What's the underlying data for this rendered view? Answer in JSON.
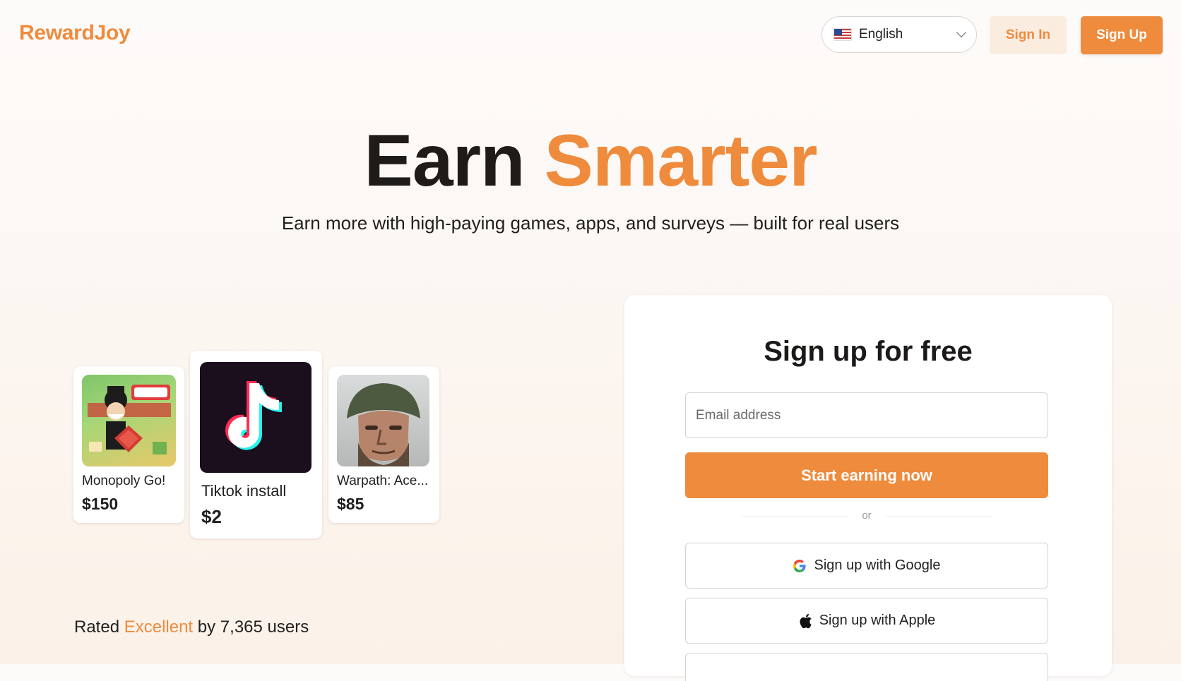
{
  "header": {
    "logo": "RewardJoy",
    "language": {
      "label": "English",
      "flag_icon": "us-flag-icon"
    },
    "sign_in_label": "Sign In",
    "sign_up_label": "Sign Up"
  },
  "hero": {
    "title_plain": "Earn",
    "title_accent": "Smarter",
    "subtitle": "Earn more with high-paying games, apps, and surveys — built for real users"
  },
  "offers": [
    {
      "name": "Monopoly Go!",
      "price": "$150",
      "icon": "monopoly-go-app-icon"
    },
    {
      "name": "Tiktok install",
      "price": "$2",
      "icon": "tiktok-app-icon"
    },
    {
      "name": "Warpath: Ace...",
      "price": "$85",
      "icon": "warpath-app-icon"
    }
  ],
  "rating": {
    "prefix": "Rated",
    "word": "Excellent",
    "suffix": "by 7,365 users"
  },
  "signup": {
    "title": "Sign up for free",
    "email_placeholder": "Email address",
    "start_label": "Start earning now",
    "or_label": "or",
    "google_label": "Sign up with Google",
    "apple_label": "Sign up with Apple"
  },
  "colors": {
    "accent": "#ef8b3c",
    "accent_light": "#fbece0",
    "background": "#fcf6f1"
  }
}
